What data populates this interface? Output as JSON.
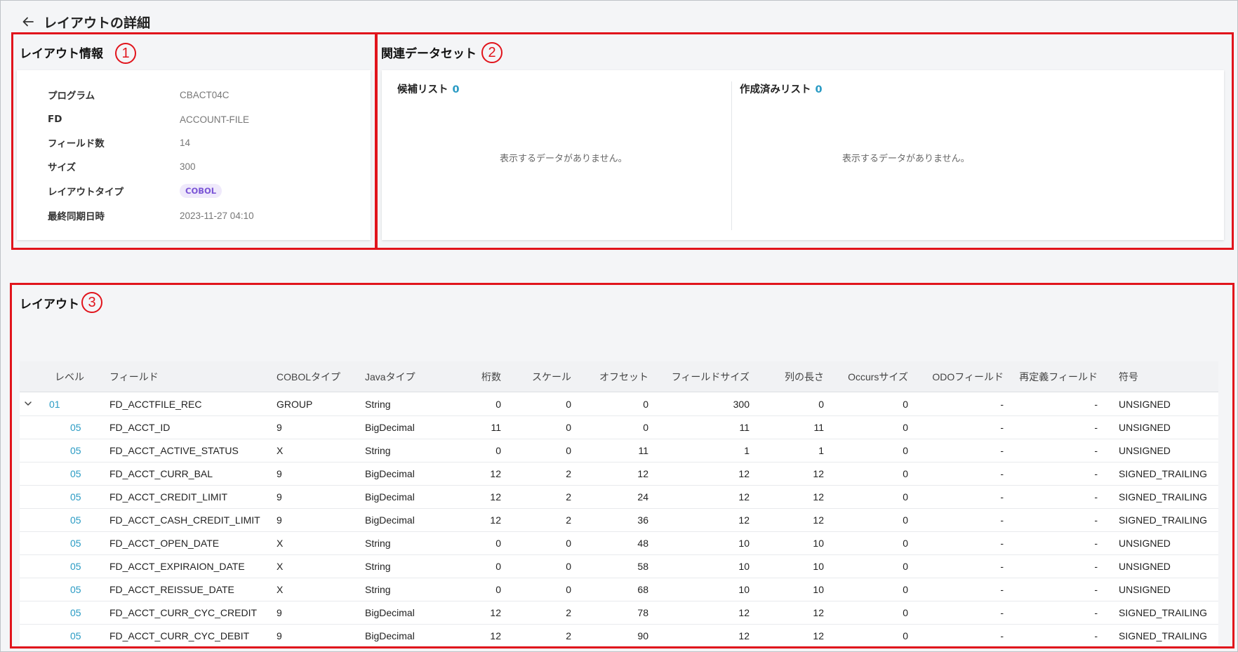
{
  "header": {
    "title": "レイアウトの詳細"
  },
  "markers": [
    "1",
    "2",
    "3"
  ],
  "layout_info": {
    "title": "レイアウト情報",
    "rows": [
      {
        "label": "プログラム",
        "value": "CBACT04C"
      },
      {
        "label": "FD",
        "value": "ACCOUNT-FILE"
      },
      {
        "label": "フィールド数",
        "value": "14"
      },
      {
        "label": "サイズ",
        "value": "300"
      },
      {
        "label": "レイアウトタイプ",
        "value": "COBOL"
      },
      {
        "label": "最終同期日時",
        "value": "2023-11-27 04:10"
      }
    ]
  },
  "related_dataset": {
    "title": "関連データセット",
    "candidate": {
      "label": "候補リスト",
      "count": "0",
      "empty": "表示するデータがありません。"
    },
    "created": {
      "label": "作成済みリスト",
      "count": "0",
      "empty": "表示するデータがありません。"
    }
  },
  "layout_table": {
    "title": "レイアウト",
    "columns": [
      "レベル",
      "フィールド",
      "COBOLタイプ",
      "Javaタイプ",
      "桁数",
      "スケール",
      "オフセット",
      "フィールドサイズ",
      "列の長さ",
      "Occursサイズ",
      "ODOフィールド",
      "再定義フィールド",
      "符号"
    ],
    "rows": [
      [
        "01",
        "FD_ACCTFILE_REC",
        "GROUP",
        "String",
        "0",
        "0",
        "0",
        "300",
        "0",
        "0",
        "-",
        "-",
        "UNSIGNED"
      ],
      [
        "05",
        "FD_ACCT_ID",
        "9",
        "BigDecimal",
        "11",
        "0",
        "0",
        "11",
        "11",
        "0",
        "-",
        "-",
        "UNSIGNED"
      ],
      [
        "05",
        "FD_ACCT_ACTIVE_STATUS",
        "X",
        "String",
        "0",
        "0",
        "11",
        "1",
        "1",
        "0",
        "-",
        "-",
        "UNSIGNED"
      ],
      [
        "05",
        "FD_ACCT_CURR_BAL",
        "9",
        "BigDecimal",
        "12",
        "2",
        "12",
        "12",
        "12",
        "0",
        "-",
        "-",
        "SIGNED_TRAILING"
      ],
      [
        "05",
        "FD_ACCT_CREDIT_LIMIT",
        "9",
        "BigDecimal",
        "12",
        "2",
        "24",
        "12",
        "12",
        "0",
        "-",
        "-",
        "SIGNED_TRAILING"
      ],
      [
        "05",
        "FD_ACCT_CASH_CREDIT_LIMIT",
        "9",
        "BigDecimal",
        "12",
        "2",
        "36",
        "12",
        "12",
        "0",
        "-",
        "-",
        "SIGNED_TRAILING"
      ],
      [
        "05",
        "FD_ACCT_OPEN_DATE",
        "X",
        "String",
        "0",
        "0",
        "48",
        "10",
        "10",
        "0",
        "-",
        "-",
        "UNSIGNED"
      ],
      [
        "05",
        "FD_ACCT_EXPIRAION_DATE",
        "X",
        "String",
        "0",
        "0",
        "58",
        "10",
        "10",
        "0",
        "-",
        "-",
        "UNSIGNED"
      ],
      [
        "05",
        "FD_ACCT_REISSUE_DATE",
        "X",
        "String",
        "0",
        "0",
        "68",
        "10",
        "10",
        "0",
        "-",
        "-",
        "UNSIGNED"
      ],
      [
        "05",
        "FD_ACCT_CURR_CYC_CREDIT",
        "9",
        "BigDecimal",
        "12",
        "2",
        "78",
        "12",
        "12",
        "0",
        "-",
        "-",
        "SIGNED_TRAILING"
      ],
      [
        "05",
        "FD_ACCT_CURR_CYC_DEBIT",
        "9",
        "BigDecimal",
        "12",
        "2",
        "90",
        "12",
        "12",
        "0",
        "-",
        "-",
        "SIGNED_TRAILING"
      ]
    ]
  },
  "icons": {
    "back": "arrow-left-icon",
    "expand": "chevron-down-icon"
  },
  "colors": {
    "annotation": "#e1141c",
    "accent": "#2a9bc4",
    "badge_bg": "#efe9fb",
    "badge_text": "#7b55d6"
  }
}
